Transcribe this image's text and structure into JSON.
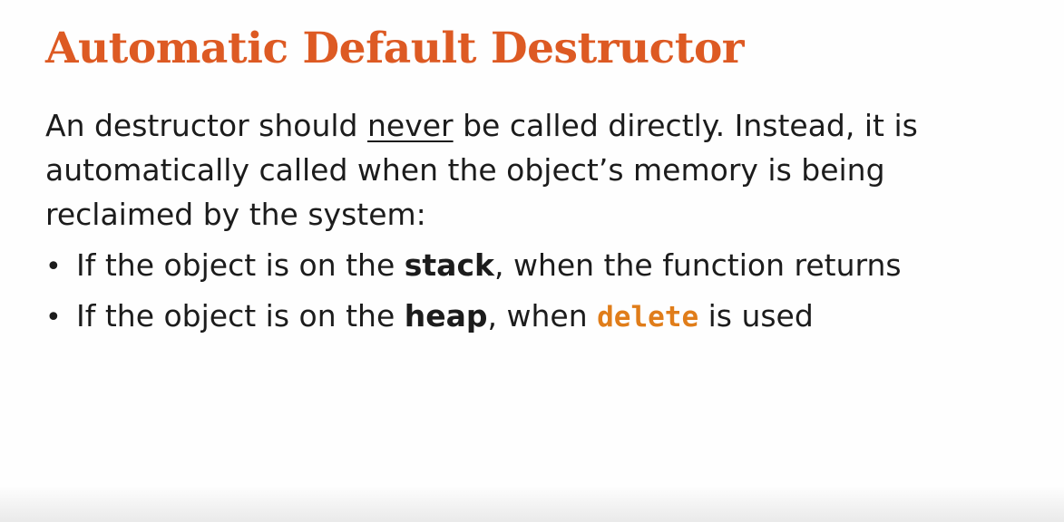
{
  "slide": {
    "title": "Automatic Default Destructor",
    "intro": {
      "part1": "An destructor should ",
      "emphasis": "never",
      "part2": " be called directly. Instead, it is automatically called when the object’s memory is being reclaimed by the system:"
    },
    "bullets": [
      {
        "glyph": "•",
        "prefix": "If the object is on the ",
        "bold": "stack",
        "suffix": ", when the function returns"
      },
      {
        "glyph": "•",
        "prefix": "If the object is on the ",
        "bold": "heap",
        "middle": ", when ",
        "code": "delete",
        "suffix": " is used"
      }
    ]
  },
  "colors": {
    "title": "#dd5a23",
    "text": "#1c1c1c",
    "code": "#e07d1a",
    "background": "#fefefe"
  }
}
